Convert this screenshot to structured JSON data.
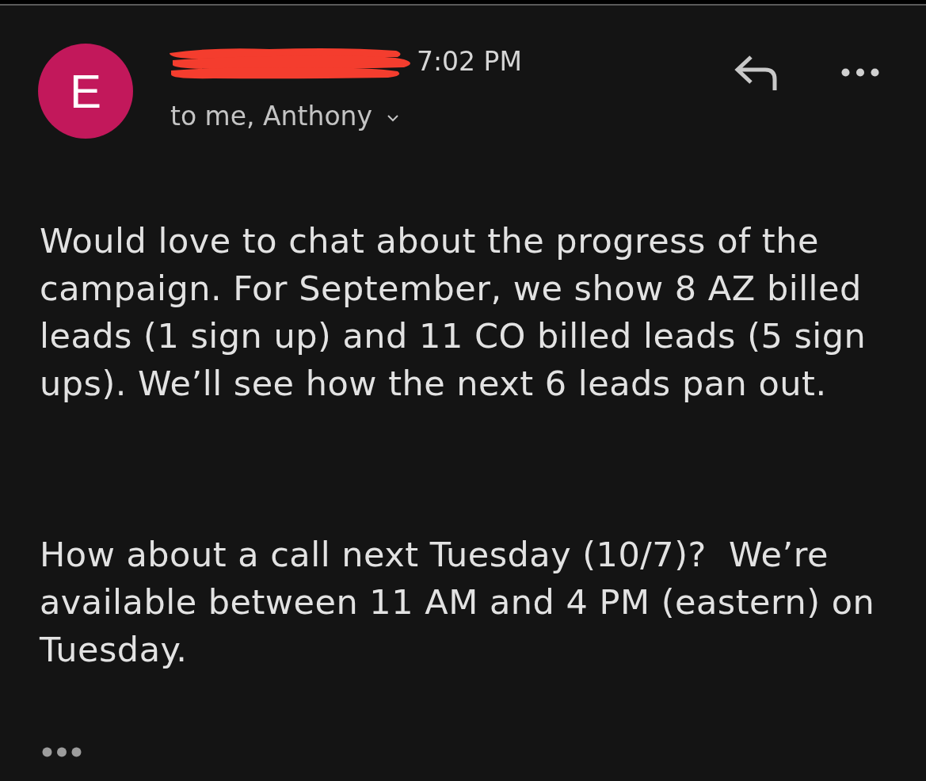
{
  "header": {
    "avatar": {
      "letter": "E"
    },
    "sender": {
      "redacted": true
    },
    "time": "7:02 PM",
    "recipients": {
      "text": "to me, Anthony",
      "expanded": false
    }
  },
  "body": {
    "paragraphs": [
      "Would love to chat about the progress of the campaign. For September, we show 8 AZ billed leads (1 sign up) and 11 CO billed leads (5 sign ups). We’ll see how the next 6 leads pan out.",
      "How about a call next Tuesday (10/7)?  We’re available between 11 AM and 4 PM (eastern) on Tuesday."
    ]
  }
}
